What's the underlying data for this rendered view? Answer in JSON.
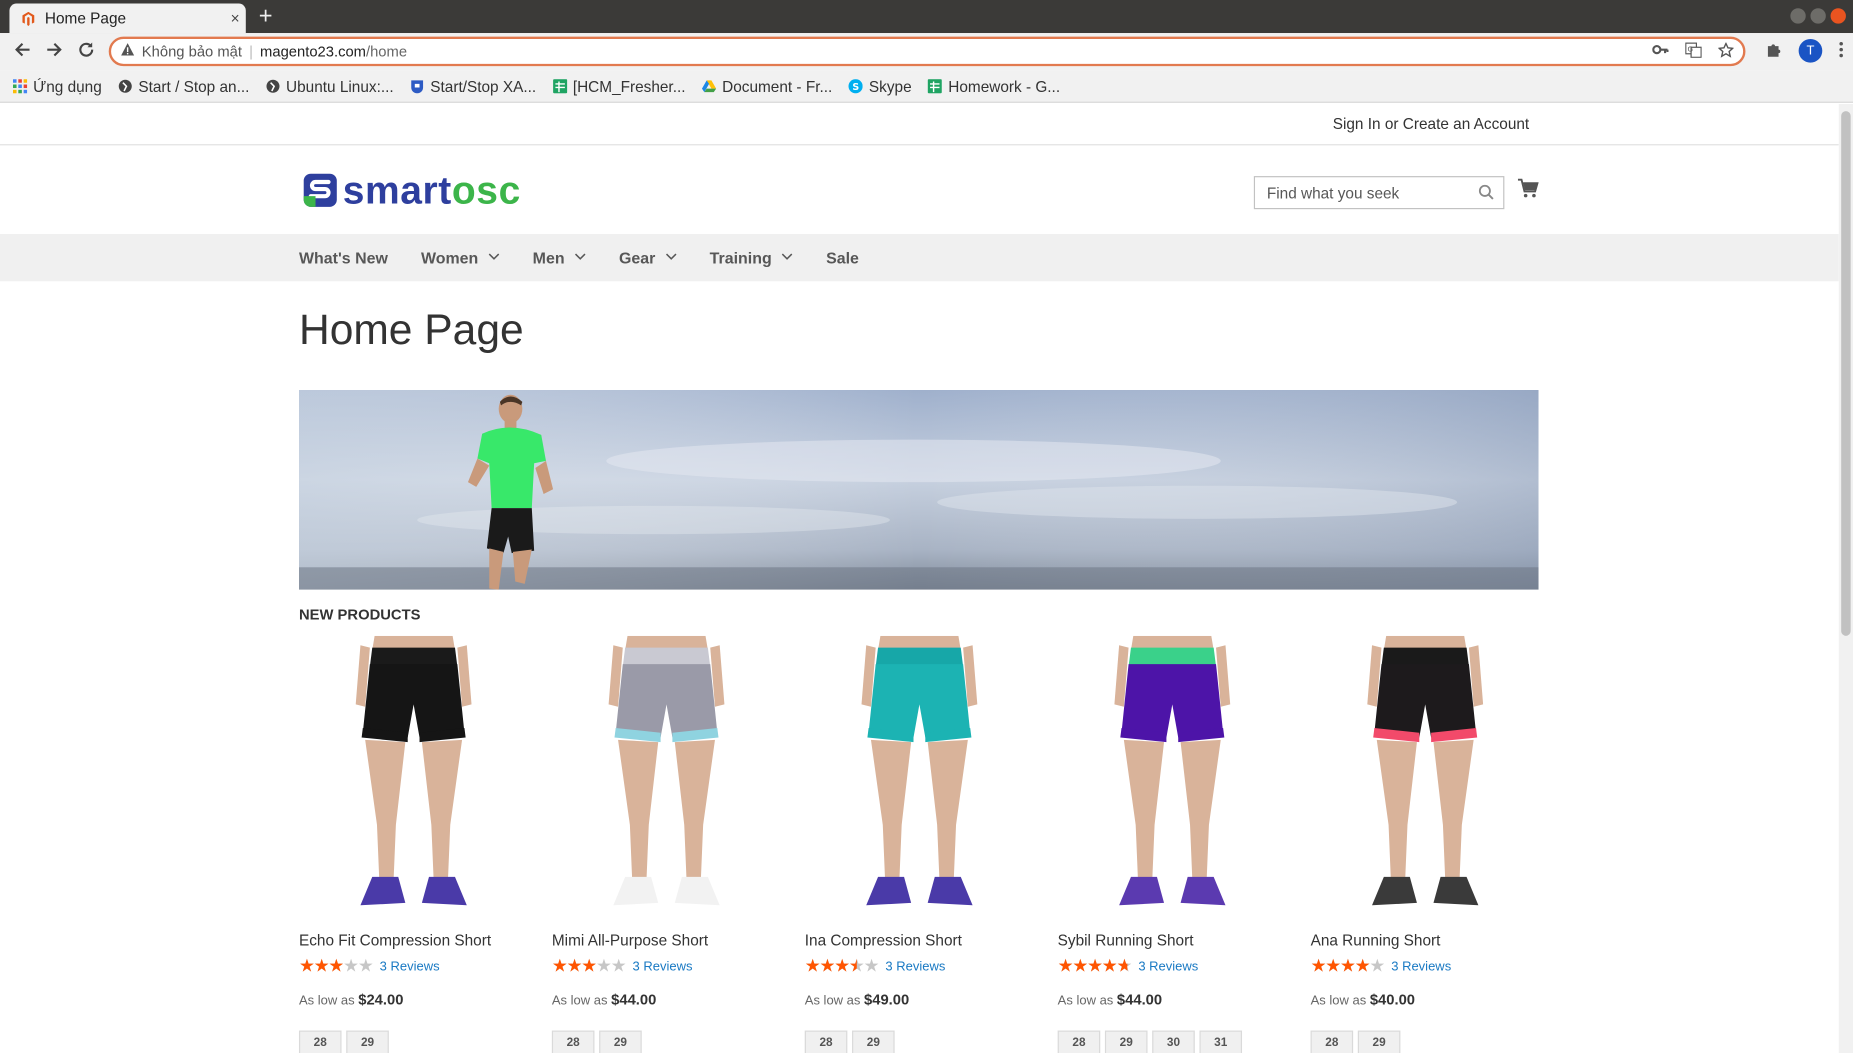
{
  "browser": {
    "tab_title": "Home Page",
    "tab_close": "×",
    "new_tab": "+",
    "security_label": "Không bảo mật",
    "url_host": "magento23.com",
    "url_path": "/home",
    "avatar_letter": "T",
    "bookmarks": [
      {
        "label": "Ứng dụng",
        "icon": "apps-grid-icon"
      },
      {
        "label": "Start / Stop an...",
        "icon": "bookmark-site-icon"
      },
      {
        "label": "Ubuntu Linux:...",
        "icon": "bookmark-site-icon"
      },
      {
        "label": "Start/Stop XA...",
        "icon": "bookmark-shield-icon"
      },
      {
        "label": "[HCM_Fresher...",
        "icon": "sheets-icon"
      },
      {
        "label": "Document - Fr...",
        "icon": "drive-icon"
      },
      {
        "label": "Skype",
        "icon": "skype-icon"
      },
      {
        "label": "Homework - G...",
        "icon": "sheets-icon"
      }
    ]
  },
  "header": {
    "sign_in": "Sign In",
    "or": " or ",
    "create_account": "Create an Account",
    "logo_part1": "smart",
    "logo_part2": "osc",
    "search_placeholder": "Find what you seek"
  },
  "nav": [
    {
      "label": "What's New",
      "has_dropdown": false
    },
    {
      "label": "Women",
      "has_dropdown": true
    },
    {
      "label": "Men",
      "has_dropdown": true
    },
    {
      "label": "Gear",
      "has_dropdown": true
    },
    {
      "label": "Training",
      "has_dropdown": true
    },
    {
      "label": "Sale",
      "has_dropdown": false
    }
  ],
  "page_title": "Home Page",
  "section_title": "NEW PRODUCTS",
  "products": [
    {
      "name": "Echo Fit Compression Short",
      "rating": 0.6,
      "reviews": "3 Reviews",
      "price_prefix": "As low as ",
      "price": "$24.00",
      "sizes": [
        "28",
        "29"
      ],
      "colors": {
        "waist": "#1a1a1a",
        "short": "#151515",
        "trim": "#151515",
        "shoe": "#4a3aa8"
      }
    },
    {
      "name": "Mimi All-Purpose Short",
      "rating": 0.6,
      "reviews": "3 Reviews",
      "price_prefix": "As low as ",
      "price": "$44.00",
      "sizes": [
        "28",
        "29"
      ],
      "colors": {
        "waist": "#c9c9d2",
        "short": "#9a9aa8",
        "trim": "#8fd3e0",
        "shoe": "#f2f2f2"
      }
    },
    {
      "name": "Ina Compression Short",
      "rating": 0.7,
      "reviews": "3 Reviews",
      "price_prefix": "As low as ",
      "price": "$49.00",
      "sizes": [
        "28",
        "29"
      ],
      "colors": {
        "waist": "#17a7a8",
        "short": "#1cb3b3",
        "trim": "#1cb3b3",
        "shoe": "#4a3aa8"
      }
    },
    {
      "name": "Sybil Running Short",
      "rating": 0.95,
      "reviews": "3 Reviews",
      "price_prefix": "As low as ",
      "price": "$44.00",
      "sizes": [
        "28",
        "29",
        "30",
        "31"
      ],
      "colors": {
        "waist": "#3ad18a",
        "short": "#4d14a8",
        "trim": "#4d14a8",
        "shoe": "#5b3ab0"
      }
    },
    {
      "name": "Ana Running Short",
      "rating": 0.8,
      "reviews": "3 Reviews",
      "price_prefix": "As low as ",
      "price": "$40.00",
      "sizes": [
        "28",
        "29"
      ],
      "colors": {
        "waist": "#1a1a1a",
        "short": "#1d1a1c",
        "trim": "#f24a6a",
        "shoe": "#3a3a3a"
      }
    }
  ],
  "colors": {
    "accent_orange": "#e27a4f",
    "star": "#ff5501",
    "link": "#1979c3",
    "logo_blue": "#2e3f9e",
    "logo_green": "#3cb54a"
  }
}
